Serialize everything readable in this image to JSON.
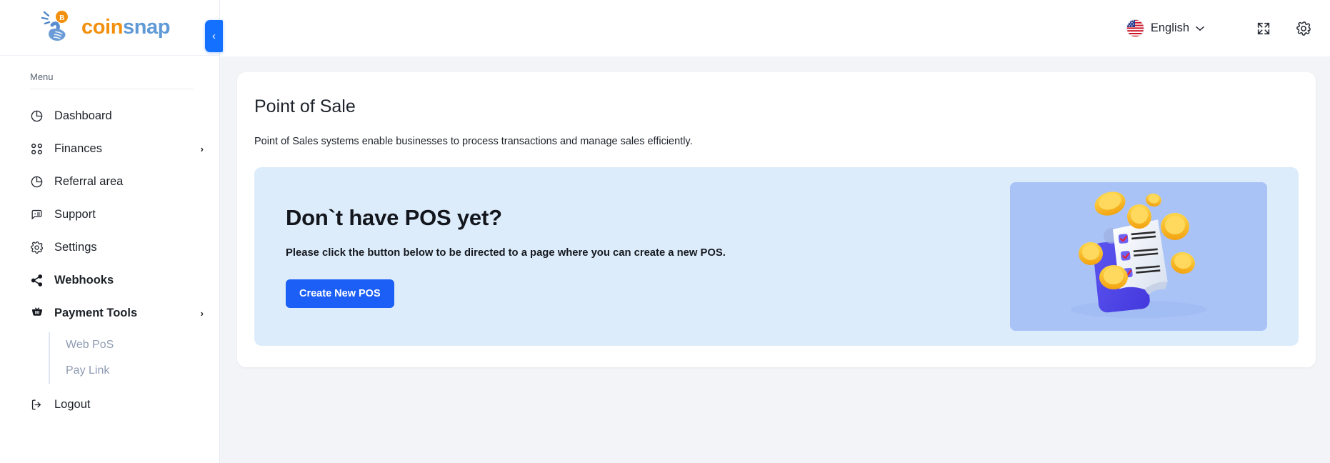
{
  "brand": {
    "name_part1": "coin",
    "name_part2": "snap",
    "logo_icon": "hand-flicking-bitcoin-coin-icon"
  },
  "sidebar": {
    "section_label": "Menu",
    "collapse_toggle": {
      "label": "‹",
      "icon": "chevron-left-icon"
    },
    "items": [
      {
        "label": "Dashboard",
        "icon": "pie-chart-icon",
        "has_chevron": false,
        "active": false
      },
      {
        "label": "Finances",
        "icon": "grid-squares-icon",
        "has_chevron": true,
        "active": false
      },
      {
        "label": "Referral area",
        "icon": "pie-chart-icon",
        "has_chevron": false,
        "active": false
      },
      {
        "label": "Support",
        "icon": "chat-bubble-icon",
        "has_chevron": false,
        "active": false
      },
      {
        "label": "Settings",
        "icon": "gear-icon",
        "has_chevron": false,
        "active": false
      },
      {
        "label": "Webhooks",
        "icon": "share-nodes-icon",
        "has_chevron": false,
        "active": true
      },
      {
        "label": "Payment Tools",
        "icon": "basket-icon",
        "has_chevron": true,
        "active": true
      }
    ],
    "submenu": [
      {
        "label": "Web PoS"
      },
      {
        "label": "Pay Link"
      }
    ],
    "logout": {
      "label": "Logout",
      "icon": "logout-icon"
    },
    "chevron_glyph": "›"
  },
  "topbar": {
    "language": {
      "label": "English",
      "flag_icon": "us-flag-icon",
      "chevron": "⌄"
    },
    "fullscreen_icon": "expand-fullscreen-icon",
    "settings_icon": "gear-icon"
  },
  "main": {
    "title": "Point of Sale",
    "description": "Point of Sales systems enable businesses to process transactions and manage sales efficiently.",
    "banner": {
      "heading": "Don`t have POS yet?",
      "paragraph": "Please click the button below to be directed to a page where you can create a new POS.",
      "button_label": "Create New POS",
      "illustration_icon": "receipt-checklist-with-coins-illustration"
    }
  },
  "colors": {
    "accent_blue": "#1b5ff7",
    "brand_orange": "#f2900d",
    "brand_blue": "#5f9ad6",
    "banner_bg": "#ddecfb",
    "page_bg": "#f2f4f8",
    "illustration_bg": "#aac3f7"
  }
}
